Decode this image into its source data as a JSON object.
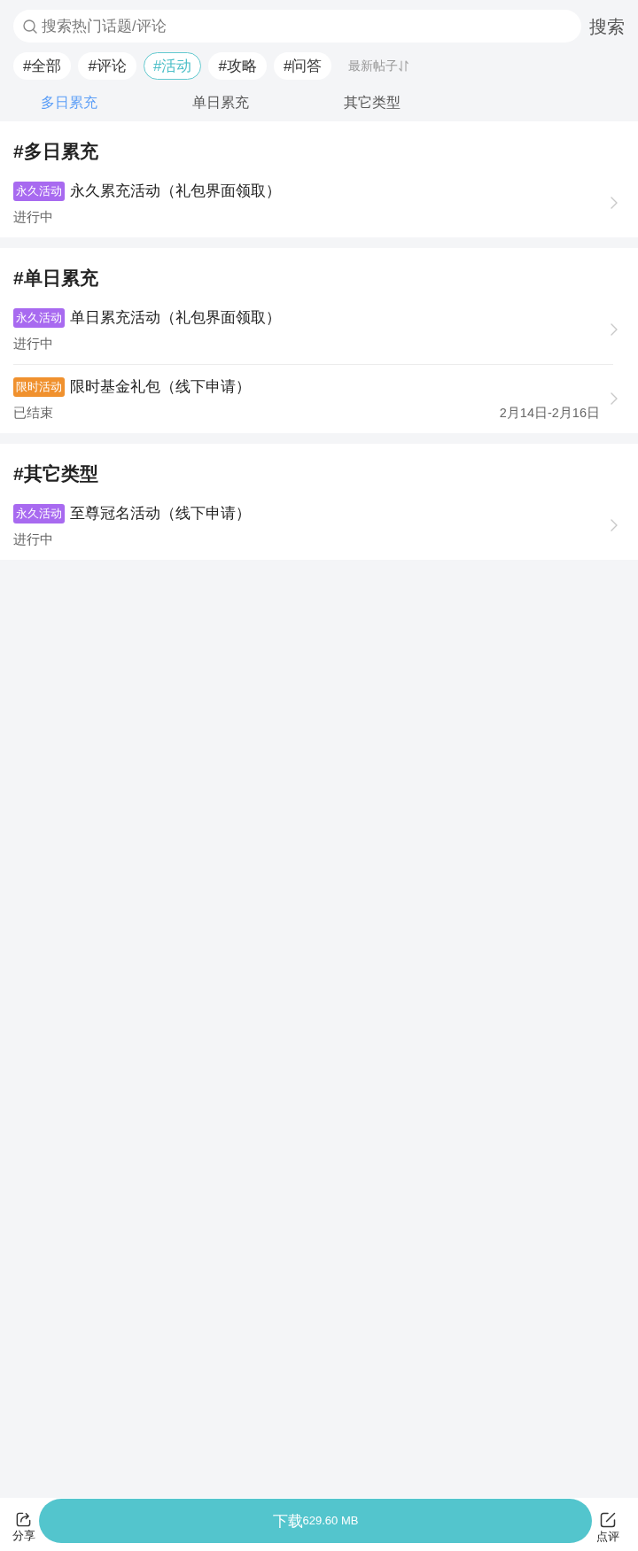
{
  "search": {
    "placeholder": "搜索热门话题/评论",
    "button": "搜索"
  },
  "filters": [
    {
      "label": "#全部",
      "selected": false
    },
    {
      "label": "#评论",
      "selected": false
    },
    {
      "label": "#活动",
      "selected": true
    },
    {
      "label": "#攻略",
      "selected": false
    },
    {
      "label": "#问答",
      "selected": false
    }
  ],
  "sort": {
    "label": "最新帖子"
  },
  "tabs": [
    {
      "label": "多日累充",
      "selected": true
    },
    {
      "label": "单日累充",
      "selected": false
    },
    {
      "label": "其它类型",
      "selected": false
    }
  ],
  "sections": [
    {
      "title": "#多日累充",
      "items": [
        {
          "tag": {
            "label": "永久活动",
            "color": "#a86af0"
          },
          "title": "永久累充活动（礼包界面领取）",
          "status": "进行中"
        }
      ]
    },
    {
      "title": "#单日累充",
      "items": [
        {
          "tag": {
            "label": "永久活动",
            "color": "#a86af0"
          },
          "title": "单日累充活动（礼包界面领取）",
          "status": "进行中"
        },
        {
          "tag": {
            "label": "限时活动",
            "color": "#f0912e"
          },
          "title": "限时基金礼包（线下申请）",
          "status": "已结束",
          "date": "2月14日-2月16日"
        }
      ]
    },
    {
      "title": "#其它类型",
      "items": [
        {
          "tag": {
            "label": "永久活动",
            "color": "#a86af0"
          },
          "title": "至尊冠名活动（线下申请）",
          "status": "进行中"
        }
      ]
    }
  ],
  "bottom_bar": {
    "share": "分享",
    "download": {
      "label": "下载",
      "size": "629.60 MB"
    },
    "review": "点评"
  }
}
